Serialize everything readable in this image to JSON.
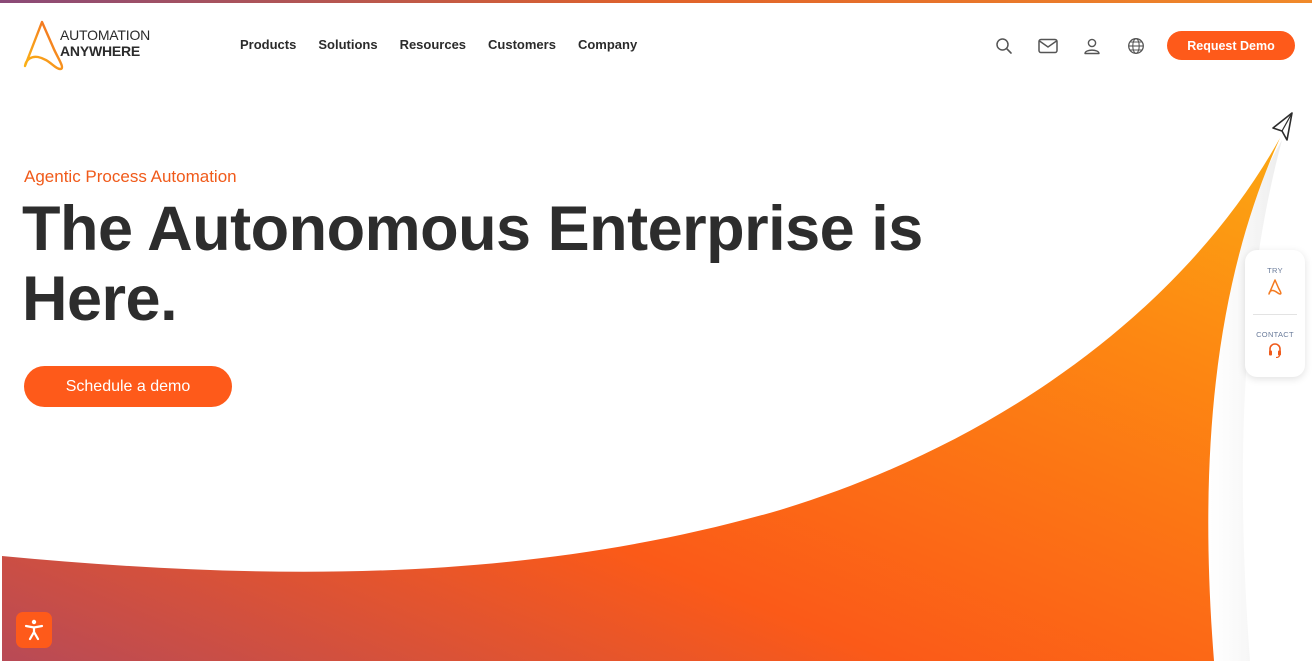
{
  "brand": {
    "name_line1": "AUTOMATION",
    "name_line2": "ANYWHERE",
    "accent_color": "#fe5a1a"
  },
  "nav": {
    "items": [
      {
        "label": "Products"
      },
      {
        "label": "Solutions"
      },
      {
        "label": "Resources"
      },
      {
        "label": "Customers"
      },
      {
        "label": "Company"
      }
    ]
  },
  "header": {
    "icons": [
      "search-icon",
      "mail-icon",
      "user-icon",
      "globe-icon"
    ],
    "cta_label": "Request Demo"
  },
  "hero": {
    "eyebrow": "Agentic Process Automation",
    "headline": "The Autonomous Enterprise is Here.",
    "cta_label": "Schedule a demo"
  },
  "side_widget": {
    "try_label": "TRY",
    "contact_label": "CONTACT"
  },
  "accessibility": {
    "icon": "accessibility-icon"
  }
}
